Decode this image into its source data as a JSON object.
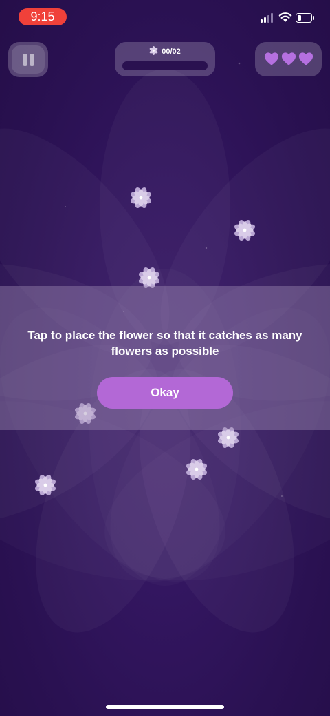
{
  "status_bar": {
    "time": "9:15",
    "signal_bars_active": 2,
    "signal_bars_total": 4,
    "battery_level": 0.25
  },
  "hud": {
    "pause_icon": "pause-icon",
    "progress_text": "00/02",
    "progress_icon": "flower-icon",
    "progress_fraction": 0.0,
    "lives": 3,
    "life_icon": "heart-icon"
  },
  "instruction": {
    "text": "Tap to place the flower so that it catches as many flowers as possible",
    "button_label": "Okay"
  },
  "colors": {
    "background": "#2d1356",
    "accent": "#b368d6",
    "heart": "#b570e0",
    "time_pill": "#f0413a",
    "flower": "#d9cce8"
  }
}
